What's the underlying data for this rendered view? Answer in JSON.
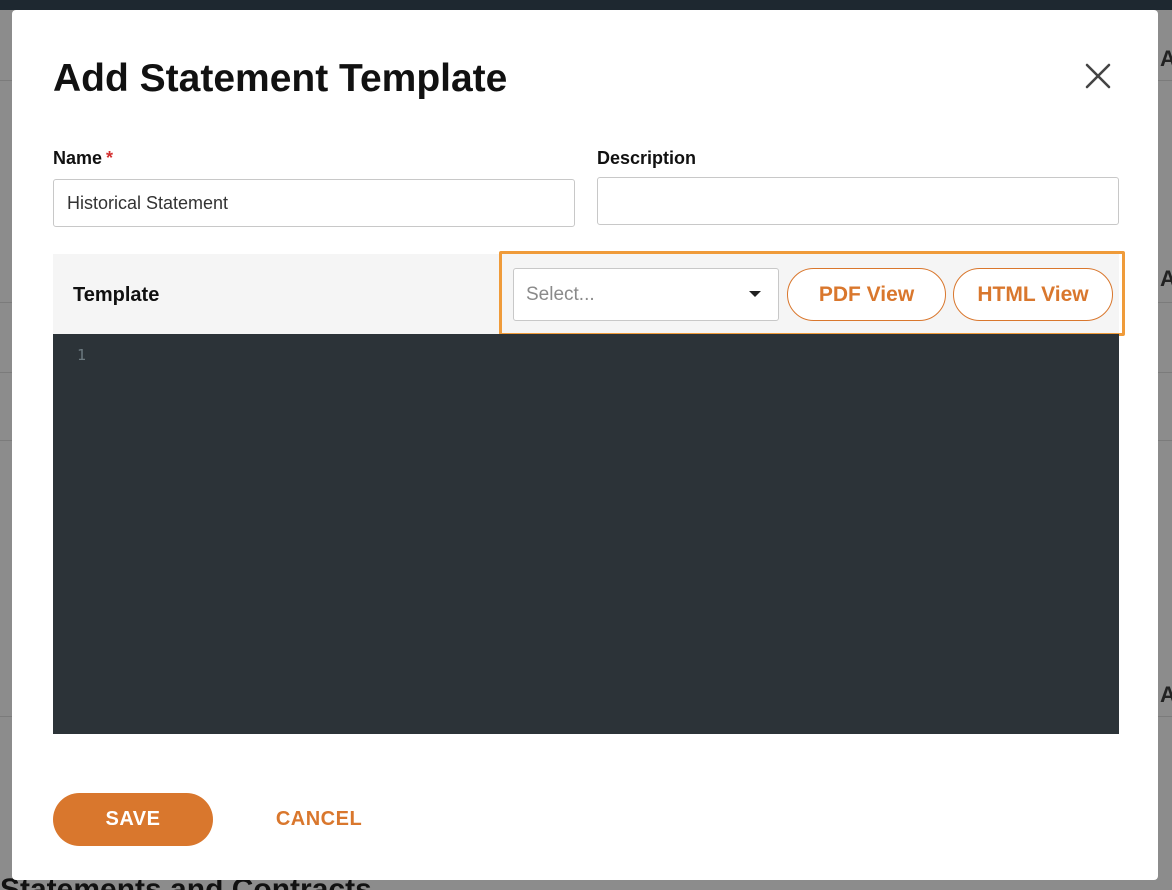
{
  "background": {
    "heading": "Statements and Contracts",
    "edge_letter": "A"
  },
  "modal": {
    "title": "Add Statement Template",
    "close_icon": "close-icon"
  },
  "form": {
    "name_label": "Name",
    "name_required_marker": "*",
    "name_value": "Historical Statement",
    "description_label": "Description",
    "description_value": ""
  },
  "template": {
    "label": "Template",
    "select_placeholder": "Select...",
    "pdf_view_label": "PDF View",
    "html_view_label": "HTML View",
    "editor_line_numbers": [
      "1"
    ]
  },
  "actions": {
    "save_label": "SAVE",
    "cancel_label": "CANCEL"
  },
  "colors": {
    "accent": "#d9772d",
    "highlight": "#ef9b3a",
    "editor_background": "#2c3338",
    "required": "#d32f2f"
  }
}
